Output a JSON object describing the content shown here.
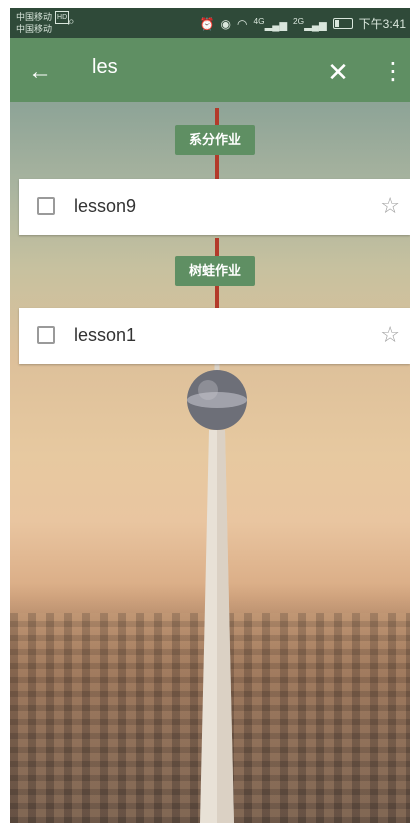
{
  "status_bar": {
    "carrier_1": "中国移动",
    "carrier_1_badge": "HD",
    "carrier_2": "中国移动",
    "network_1": "4G",
    "network_2": "2G",
    "time": "下午3:41"
  },
  "toolbar": {
    "search_query": "les",
    "back_icon": "←",
    "clear_icon": "✕",
    "more_icon": "⋮"
  },
  "results": [
    {
      "group": "系分作业",
      "task": {
        "title": "lesson9",
        "checked": false,
        "starred": false
      }
    },
    {
      "group": "树蛙作业",
      "task": {
        "title": "lesson1",
        "checked": false,
        "starred": false
      }
    }
  ],
  "icons": {
    "star": "☆",
    "search": "⌕"
  },
  "colors": {
    "toolbar": "#5f8f63",
    "status_bar": "#2f4a39",
    "tag": "#5f8f63"
  }
}
